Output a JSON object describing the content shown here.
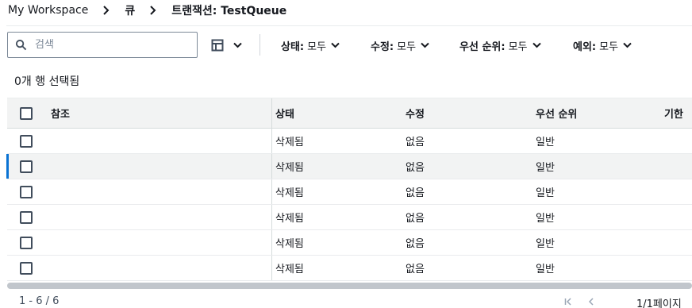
{
  "breadcrumb": {
    "items": [
      "My Workspace",
      "큐",
      "트랜잭션: TestQueue"
    ]
  },
  "toolbar": {
    "search_placeholder": "검색",
    "filters": [
      {
        "label": "상태:",
        "value": "모두"
      },
      {
        "label": "수정:",
        "value": "모두"
      },
      {
        "label": "우선 순위:",
        "value": "모두"
      },
      {
        "label": "예외:",
        "value": "모두"
      }
    ]
  },
  "selection": {
    "text": "0개 행 선택됨"
  },
  "table": {
    "headers": [
      "참조",
      "상태",
      "수정",
      "우선 순위",
      "기한"
    ],
    "rows": [
      {
        "ref": "",
        "status": "삭제됨",
        "fix": "없음",
        "priority": "일반"
      },
      {
        "ref": "",
        "status": "삭제됨",
        "fix": "없음",
        "priority": "일반"
      },
      {
        "ref": "",
        "status": "삭제됨",
        "fix": "없음",
        "priority": "일반"
      },
      {
        "ref": "",
        "status": "삭제됨",
        "fix": "없음",
        "priority": "일반"
      },
      {
        "ref": "",
        "status": "삭제됨",
        "fix": "없음",
        "priority": "일반"
      },
      {
        "ref": "",
        "status": "삭제됨",
        "fix": "없음",
        "priority": "일반"
      }
    ]
  },
  "footer": {
    "count": "1 - 6 / 6",
    "page": "1/1페이지"
  },
  "icons": {
    "search": "search-icon",
    "table_prefs": "table-settings-icon",
    "chevron": "chevron-down-icon",
    "first_page": "first-page-icon",
    "prev_page": "previous-page-icon"
  },
  "colors": {
    "accent": "#0972d3",
    "text": "#16191f",
    "header_bg": "#f2f3f3"
  }
}
